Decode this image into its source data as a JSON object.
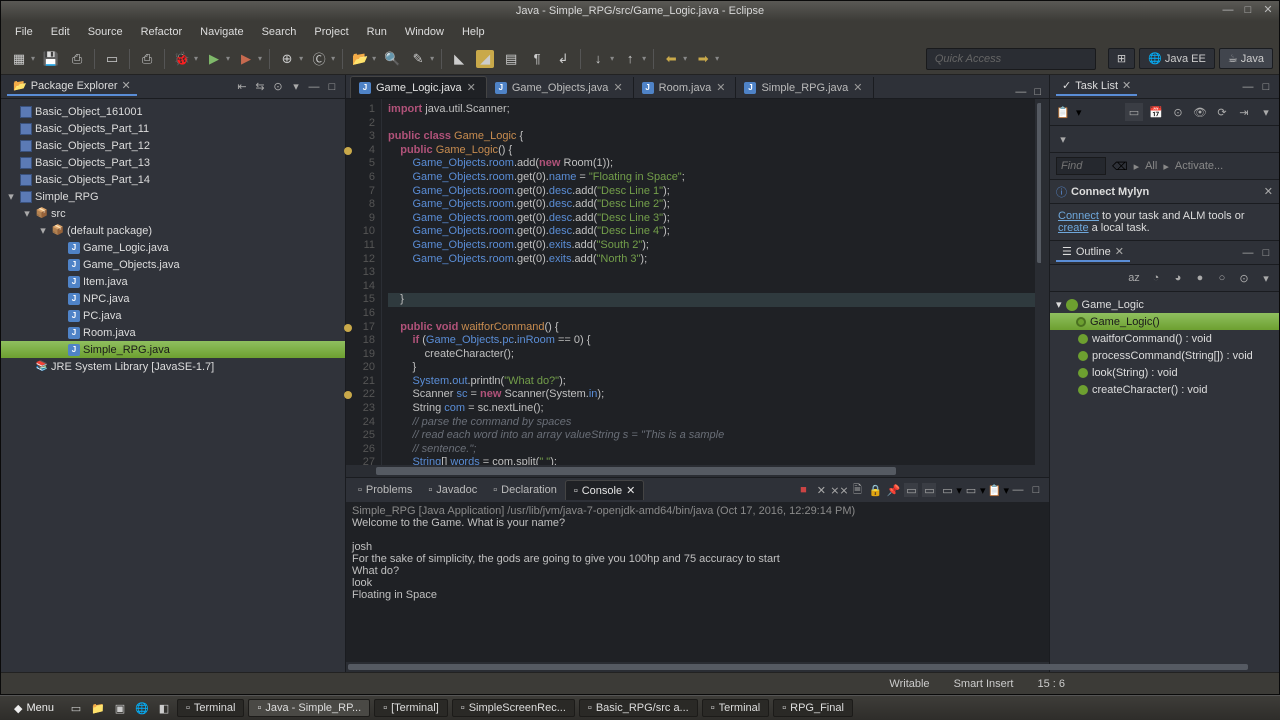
{
  "title": "Java - Simple_RPG/src/Game_Logic.java - Eclipse",
  "menu": [
    "File",
    "Edit",
    "Source",
    "Refactor",
    "Navigate",
    "Search",
    "Project",
    "Run",
    "Window",
    "Help"
  ],
  "quick_access_placeholder": "Quick Access",
  "perspectives": [
    {
      "label": "Java EE",
      "active": false
    },
    {
      "label": "Java",
      "active": true
    }
  ],
  "package_explorer": {
    "title": "Package Explorer",
    "projects": [
      {
        "name": "Basic_Object_161001",
        "expanded": false
      },
      {
        "name": "Basic_Objects_Part_11",
        "expanded": false
      },
      {
        "name": "Basic_Objects_Part_12",
        "expanded": false
      },
      {
        "name": "Basic_Objects_Part_13",
        "expanded": false
      },
      {
        "name": "Basic_Objects_Part_14",
        "expanded": false
      },
      {
        "name": "Simple_RPG",
        "expanded": true,
        "children": [
          {
            "name": "src",
            "type": "srcfolder",
            "expanded": true,
            "children": [
              {
                "name": "(default package)",
                "type": "package",
                "expanded": true,
                "children": [
                  {
                    "name": "Game_Logic.java",
                    "type": "java"
                  },
                  {
                    "name": "Game_Objects.java",
                    "type": "java"
                  },
                  {
                    "name": "Item.java",
                    "type": "java"
                  },
                  {
                    "name": "NPC.java",
                    "type": "java"
                  },
                  {
                    "name": "PC.java",
                    "type": "java"
                  },
                  {
                    "name": "Room.java",
                    "type": "java"
                  },
                  {
                    "name": "Simple_RPG.java",
                    "type": "java",
                    "selected": true
                  }
                ]
              }
            ]
          },
          {
            "name": "JRE System Library [JavaSE-1.7]",
            "type": "library"
          }
        ]
      }
    ]
  },
  "editor_tabs": [
    {
      "label": "Game_Logic.java",
      "active": true,
      "closable": true
    },
    {
      "label": "Game_Objects.java",
      "active": false,
      "closable": true
    },
    {
      "label": "Room.java",
      "active": false,
      "closable": true
    },
    {
      "label": "Simple_RPG.java",
      "active": false,
      "closable": true
    }
  ],
  "code_lines": [
    {
      "n": 1,
      "html": "<span class='kw'>import</span> java.util.Scanner;"
    },
    {
      "n": 2,
      "html": ""
    },
    {
      "n": 3,
      "html": "<span class='kw'>public</span> <span class='kw'>class</span> <span class='cls'>Game_Logic</span> {"
    },
    {
      "n": 4,
      "html": "    <span class='kw'>public</span> <span class='cls'>Game_Logic</span>() {",
      "mark": true
    },
    {
      "n": 5,
      "html": "        <span class='type'>Game_Objects</span>.<span class='field'>room</span>.add(<span class='kw'>new</span> Room(<span class='num'>1</span>));"
    },
    {
      "n": 6,
      "html": "        <span class='type'>Game_Objects</span>.<span class='field'>room</span>.get(<span class='num'>0</span>).<span class='field'>name</span> = <span class='str'>\"Floating in Space\"</span>;"
    },
    {
      "n": 7,
      "html": "        <span class='type'>Game_Objects</span>.<span class='field'>room</span>.get(<span class='num'>0</span>).<span class='field'>desc</span>.add(<span class='str'>\"Desc Line 1\"</span>);"
    },
    {
      "n": 8,
      "html": "        <span class='type'>Game_Objects</span>.<span class='field'>room</span>.get(<span class='num'>0</span>).<span class='field'>desc</span>.add(<span class='str'>\"Desc Line 2\"</span>);"
    },
    {
      "n": 9,
      "html": "        <span class='type'>Game_Objects</span>.<span class='field'>room</span>.get(<span class='num'>0</span>).<span class='field'>desc</span>.add(<span class='str'>\"Desc Line 3\"</span>);"
    },
    {
      "n": 10,
      "html": "        <span class='type'>Game_Objects</span>.<span class='field'>room</span>.get(<span class='num'>0</span>).<span class='field'>desc</span>.add(<span class='str'>\"Desc Line 4\"</span>);"
    },
    {
      "n": 11,
      "html": "        <span class='type'>Game_Objects</span>.<span class='field'>room</span>.get(<span class='num'>0</span>).<span class='field'>exits</span>.add(<span class='str'>\"South 2\"</span>);"
    },
    {
      "n": 12,
      "html": "        <span class='type'>Game_Objects</span>.<span class='field'>room</span>.get(<span class='num'>0</span>).<span class='field'>exits</span>.add(<span class='str'>\"North 3\"</span>);"
    },
    {
      "n": 13,
      "html": ""
    },
    {
      "n": 14,
      "html": ""
    },
    {
      "n": 15,
      "html": "    }",
      "hl": true
    },
    {
      "n": 16,
      "html": ""
    },
    {
      "n": 17,
      "html": "    <span class='kw'>public</span> <span class='kw'>void</span> <span class='cls'>waitforCommand</span>() {",
      "mark": true
    },
    {
      "n": 18,
      "html": "        <span class='kw'>if</span> (<span class='type'>Game_Objects</span>.<span class='field'>pc</span>.<span class='field'>inRoom</span> == <span class='num'>0</span>) {"
    },
    {
      "n": 19,
      "html": "            createCharacter();"
    },
    {
      "n": 20,
      "html": "        }"
    },
    {
      "n": 21,
      "html": "        <span class='type'>System</span>.<span class='field'>out</span>.println(<span class='str'>\"What do?\"</span>);"
    },
    {
      "n": 22,
      "html": "        Scanner <span class='field'>sc</span> = <span class='kw'>new</span> Scanner(System.<span class='field'>in</span>);",
      "mark": true
    },
    {
      "n": 23,
      "html": "        String <span class='field'>com</span> = sc.nextLine();"
    },
    {
      "n": 24,
      "html": "        <span class='cmt'>// parse the command by spaces</span>"
    },
    {
      "n": 25,
      "html": "        <span class='cmt'>// read each word into an array valueString s = \"This is a sample</span>"
    },
    {
      "n": 26,
      "html": "        <span class='cmt'>// sentence.\";</span>"
    },
    {
      "n": 27,
      "html": "        <span class='type'>String</span>[] <span class='field'>words</span> = com.split(<span class='str'>\" \"</span>);"
    }
  ],
  "bottom_tabs": [
    {
      "label": "Problems",
      "active": false
    },
    {
      "label": "Javadoc",
      "active": false
    },
    {
      "label": "Declaration",
      "active": false
    },
    {
      "label": "Console",
      "active": true,
      "closable": true
    }
  ],
  "console": {
    "header": "Simple_RPG [Java Application] /usr/lib/jvm/java-7-openjdk-amd64/bin/java (Oct 17, 2016, 12:29:14 PM)",
    "lines": [
      "Welcome to the Game. What is your name?",
      "",
      "josh",
      "For the sake of simplicity, the gods are going to give you 100hp and 75 accuracy to start",
      "What do?",
      "look",
      "Floating in Space"
    ]
  },
  "status_bar": {
    "writable": "Writable",
    "insert": "Smart Insert",
    "pos": "15 : 6"
  },
  "right": {
    "tasklist_title": "Task List",
    "mylyn_title": "Connect Mylyn",
    "mylyn_body_a": "Connect",
    "mylyn_body_b": " to your task and ALM tools or ",
    "mylyn_body_c": "create",
    "mylyn_body_d": " a local task.",
    "outline_title": "Outline",
    "outline": [
      {
        "label": "Game_Logic",
        "kind": "class",
        "children": [
          {
            "label": "Game_Logic()",
            "kind": "ctor",
            "selected": true
          },
          {
            "label": "waitforCommand() : void",
            "kind": "method"
          },
          {
            "label": "processCommand(String[]) : void",
            "kind": "method"
          },
          {
            "label": "look(String) : void",
            "kind": "method"
          },
          {
            "label": "createCharacter() : void",
            "kind": "method"
          }
        ]
      }
    ],
    "find_placeholder": "Find",
    "all_label": "All",
    "activate_label": "Activate..."
  },
  "taskbar": {
    "menu": "Menu",
    "items": [
      {
        "label": "Terminal",
        "active": false
      },
      {
        "label": "Java - Simple_RP...",
        "active": true
      },
      {
        "label": "[Terminal]",
        "active": false
      },
      {
        "label": "SimpleScreenRec...",
        "active": false
      },
      {
        "label": "Basic_RPG/src a...",
        "active": false
      },
      {
        "label": "Terminal",
        "active": false
      },
      {
        "label": "RPG_Final",
        "active": false
      }
    ]
  }
}
